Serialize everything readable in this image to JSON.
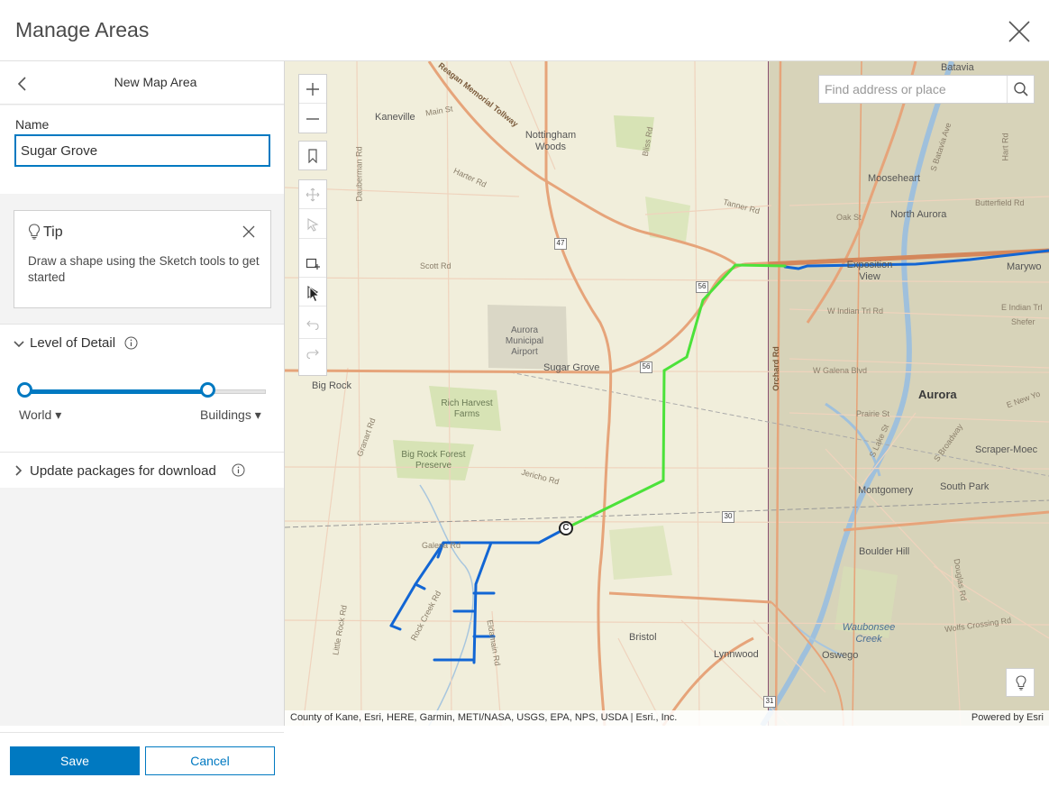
{
  "header": {
    "title": "Manage Areas"
  },
  "panel": {
    "nav_title": "New Map Area",
    "name_label": "Name",
    "name_value": "Sugar Grove",
    "tip": {
      "title": "Tip",
      "text": "Draw a shape using the Sketch tools to get started"
    },
    "level_of_detail": {
      "title": "Level of Detail",
      "min_label": "World",
      "max_label": "Buildings",
      "range_start": 0.0,
      "range_end": 0.76
    },
    "update_packages": {
      "title": "Update packages for download"
    },
    "save_label": "Save",
    "cancel_label": "Cancel"
  },
  "map": {
    "search_placeholder": "Find address or place",
    "attribution": "County of Kane, Esri, HERE, Garmin, METI/NASA, USGS, EPA, NPS, USDA | Esri., Inc.",
    "powered_by": "Powered by Esri",
    "places": {
      "batavia": "Batavia",
      "kaneville": "Kaneville",
      "nottingham_woods": "Nottingham Woods",
      "mooseheart": "Mooseheart",
      "north_aurora": "North Aurora",
      "exposition_view": "Exposition View",
      "marywood": "Marywo",
      "aurora_airport": "Aurora Municipal Airport",
      "sugar_grove": "Sugar Grove",
      "big_rock": "Big Rock",
      "aurora": "Aurora",
      "rich_harvest_farms": "Rich Harvest Farms",
      "big_rock_forest_preserve": "Big Rock Forest Preserve",
      "montgomery": "Montgomery",
      "south_park": "South Park",
      "scraper_moecherville": "Scraper-Moec",
      "boulder_hill": "Boulder Hill",
      "bristol": "Bristol",
      "lynnwood": "Lynnwood",
      "oswego": "Oswego",
      "waubonsee_creek": "Waubonsee Creek"
    },
    "roads": {
      "reagan_tollway": "Reagan Memorial Tollway",
      "main_st": "Main St",
      "dauberman_rd": "Dauberman Rd",
      "harter_rd": "Harter Rd",
      "bliss_rd": "Bliss Rd",
      "tanner_rd": "Tanner Rd",
      "scott_rd": "Scott Rd",
      "oak_st": "Oak St",
      "butterfield_rd": "Butterfield Rd",
      "w_indian_trail": "W Indian Trl Rd",
      "e_indian_trail": "E Indian Trl",
      "w_galena_blvd": "W Galena Blvd",
      "prairie_st": "Prairie St",
      "jericho_rd": "Jericho Rd",
      "galena_rd": "Galena Rd",
      "orchard_rd": "Orchard Rd",
      "granart_rd": "Granart Rd",
      "little_rock_rd": "Little Rock Rd",
      "rock_creek_rd": "Rock Creek Rd",
      "eldamain_rd": "Eldamain Rd",
      "wolfs_crossing": "Wolfs Crossing Rd",
      "douglas_rd": "Douglas Rd",
      "hart_rd": "Hart Rd",
      "e_new_york": "E New Yo",
      "s_broadway": "S Broadway",
      "s_lake_st": "S Lake St",
      "s_batavia": "S Batavia Ave",
      "shefer": "Shefer"
    },
    "shields": {
      "rt47": "47",
      "rt56a": "56",
      "rt56b": "56",
      "rt30": "30",
      "rt31": "31"
    },
    "markers": {
      "point_c": "C"
    }
  }
}
